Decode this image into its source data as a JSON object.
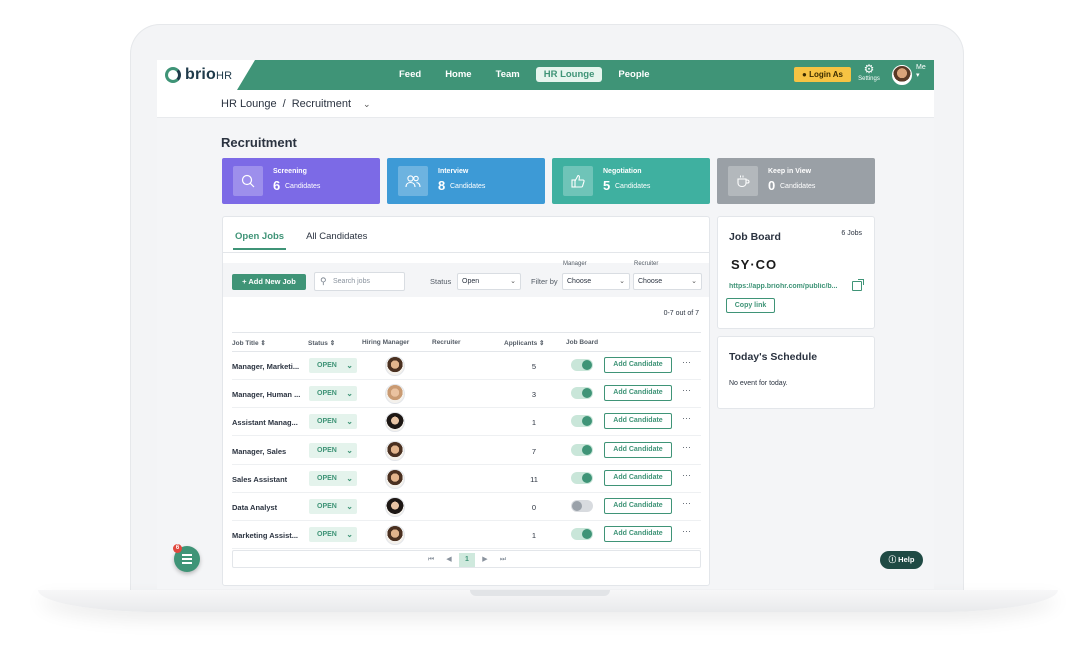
{
  "app": {
    "logo_text": "brio",
    "logo_suffix": "HR"
  },
  "nav": {
    "links": [
      "Feed",
      "Home",
      "Team",
      "HR Lounge",
      "People"
    ],
    "active": "HR Lounge",
    "login_as": "Login As",
    "settings_label": "Settings",
    "me_label": "Me"
  },
  "breadcrumb": {
    "root": "HR Lounge",
    "separator": "/",
    "current": "Recruitment"
  },
  "page_title": "Recruitment",
  "stages": [
    {
      "name": "Screening",
      "count": "6",
      "unit": "Candidates",
      "color": "#7c6ae6",
      "icon": "search-icon"
    },
    {
      "name": "Interview",
      "count": "8",
      "unit": "Candidates",
      "color": "#3d9ad6",
      "icon": "people-icon"
    },
    {
      "name": "Negotiation",
      "count": "5",
      "unit": "Candidates",
      "color": "#3fb0a0",
      "icon": "thumbs-up-icon"
    },
    {
      "name": "Keep in View",
      "count": "0",
      "unit": "Candidates",
      "color": "#9aa0a6",
      "icon": "coffee-cup-icon"
    }
  ],
  "tabs": [
    "Open Jobs",
    "All Candidates"
  ],
  "filters": {
    "add_job": "+ Add New Job",
    "search_placeholder": "Search jobs",
    "status_label": "Status",
    "status_value": "Open",
    "filter_by_label": "Filter by",
    "manager_label": "Manager",
    "manager_value": "Choose",
    "recruiter_label": "Recruiter",
    "recruiter_value": "Choose"
  },
  "results_count": "0-7 out of 7",
  "table": {
    "headers": [
      "Job Title",
      "Status",
      "Hiring Manager",
      "Recruiter",
      "Applicants",
      "Job Board"
    ],
    "rows": [
      {
        "title": "Manager, Marketi...",
        "status": "OPEN",
        "applicants": "5",
        "job_board": true,
        "action": "Add Candidate"
      },
      {
        "title": "Manager, Human ...",
        "status": "OPEN",
        "applicants": "3",
        "job_board": true,
        "action": "Add Candidate"
      },
      {
        "title": "Assistant Manag...",
        "status": "OPEN",
        "applicants": "1",
        "job_board": true,
        "action": "Add Candidate"
      },
      {
        "title": "Manager, Sales",
        "status": "OPEN",
        "applicants": "7",
        "job_board": true,
        "action": "Add Candidate"
      },
      {
        "title": "Sales Assistant",
        "status": "OPEN",
        "applicants": "11",
        "job_board": true,
        "action": "Add Candidate"
      },
      {
        "title": "Data Analyst",
        "status": "OPEN",
        "applicants": "0",
        "job_board": false,
        "action": "Add Candidate"
      },
      {
        "title": "Marketing Assist...",
        "status": "OPEN",
        "applicants": "1",
        "job_board": true,
        "action": "Add Candidate"
      }
    ],
    "more_label": "···"
  },
  "pager": {
    "first": "⏮",
    "prev": "◀",
    "page": "1",
    "next": "▶",
    "last": "⏭"
  },
  "job_board": {
    "title": "Job Board",
    "count": "6 Jobs",
    "company_logo": "SY·CO",
    "url": "https://app.briohr.com/public/b...",
    "copy_label": "Copy link"
  },
  "schedule": {
    "title": "Today's Schedule",
    "empty": "No event for today."
  },
  "fab_badge": "6",
  "help_label": "Help"
}
